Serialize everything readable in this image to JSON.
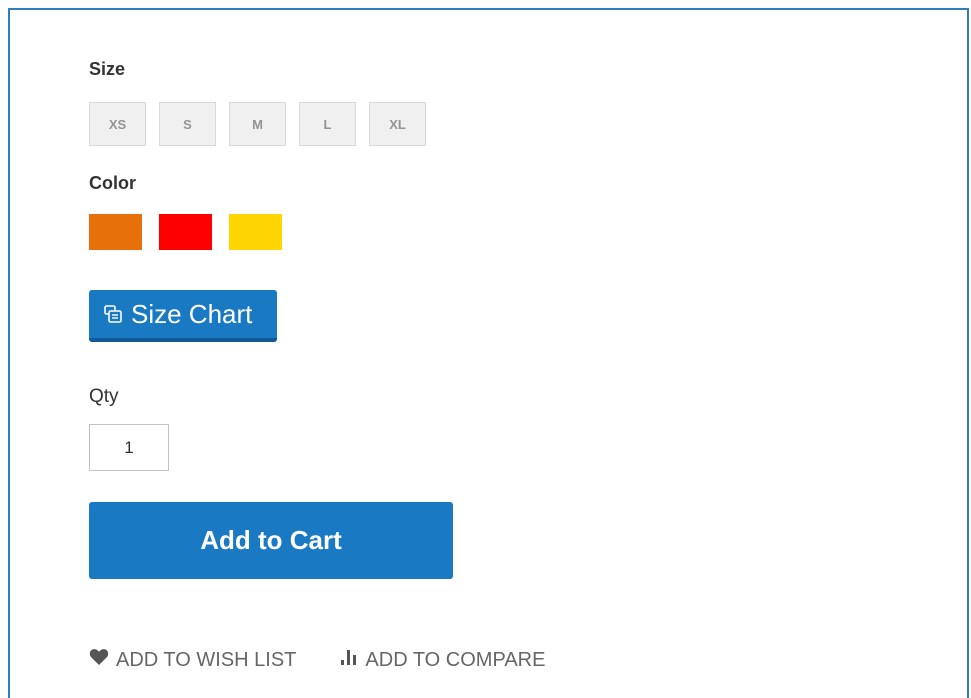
{
  "size_section": {
    "label": "Size",
    "options": [
      "XS",
      "S",
      "M",
      "L",
      "XL"
    ]
  },
  "color_section": {
    "label": "Color",
    "options": [
      {
        "name": "orange",
        "hex": "#e8700a"
      },
      {
        "name": "red",
        "hex": "#fe0000"
      },
      {
        "name": "yellow",
        "hex": "#ffd500"
      }
    ]
  },
  "size_chart_button": {
    "label": "Size Chart",
    "icon": "size-chart-icon"
  },
  "qty": {
    "label": "Qty",
    "value": "1"
  },
  "add_to_cart": {
    "label": "Add to Cart"
  },
  "actions": {
    "wishlist": {
      "label": "ADD TO WISH LIST",
      "icon": "heart-icon"
    },
    "compare": {
      "label": "ADD TO COMPARE",
      "icon": "bar-chart-icon"
    }
  },
  "colors": {
    "primary": "#1979c3",
    "frame_border": "#2f7fbf"
  }
}
